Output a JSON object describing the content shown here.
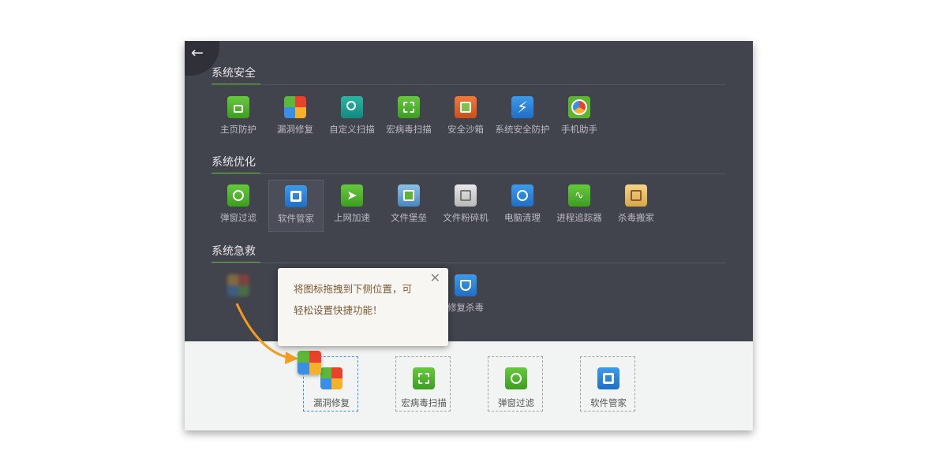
{
  "sections": [
    {
      "title": "系统安全",
      "items": [
        "主页防护",
        "漏洞修复",
        "自定义扫描",
        "宏病毒扫描",
        "安全沙箱",
        "系统安全防护",
        "手机助手"
      ]
    },
    {
      "title": "系统优化",
      "items": [
        "弹窗过滤",
        "软件管家",
        "上网加速",
        "文件堡垒",
        "文件粉碎机",
        "电脑清理",
        "进程追踪器",
        "杀毒搬家"
      ]
    },
    {
      "title": "系统急救",
      "items": [
        "修复杀毒"
      ]
    }
  ],
  "tooltip": {
    "line1": "将图标拖拽到下侧位置，可",
    "line2": "轻松设置快捷功能！"
  },
  "shortcuts": [
    "漏洞修复",
    "宏病毒扫描",
    "弹窗过滤",
    "软件管家"
  ],
  "colors": {
    "panel": "#41434d",
    "accent": "#5cb531",
    "shortcut_bar": "#f2f3f3",
    "drag_arrow": "#f39c20"
  }
}
